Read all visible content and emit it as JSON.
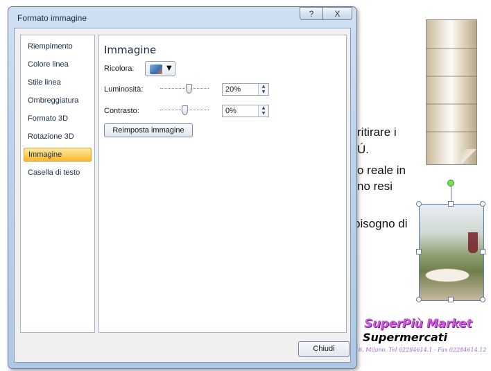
{
  "dialog": {
    "title": "Formato immagine",
    "help_label": "?",
    "close_label": "X",
    "nav_items": [
      {
        "label": "Riempimento"
      },
      {
        "label": "Colore linea"
      },
      {
        "label": "Stile linea"
      },
      {
        "label": "Ombreggiatura"
      },
      {
        "label": "Formato 3D"
      },
      {
        "label": "Rotazione 3D"
      },
      {
        "label": "Immagine"
      },
      {
        "label": "Casella di testo"
      }
    ],
    "selected_nav": "Immagine",
    "section_title": "Immagine",
    "recolor": {
      "label": "Ricolora:",
      "icon": "recolor-icon",
      "arrow": "▼"
    },
    "brightness": {
      "label": "Luminosità:",
      "value": "20%",
      "level": 0.6
    },
    "contrast": {
      "label": "Contrasto:",
      "value": "0%",
      "level": 0.5
    },
    "reset_label": "Reimposta immagine",
    "close_button_label": "Chiudi"
  },
  "slide": {
    "text_lines": [
      "ritirare i",
      "Ú.",
      "o reale in",
      "no resi",
      "bisogno di"
    ],
    "logo_line1": "SuperPiù Market",
    "logo_line2": "Supermercati",
    "address": "16, Milano, Tel 02284614.1  - Fax 02284614.12"
  }
}
